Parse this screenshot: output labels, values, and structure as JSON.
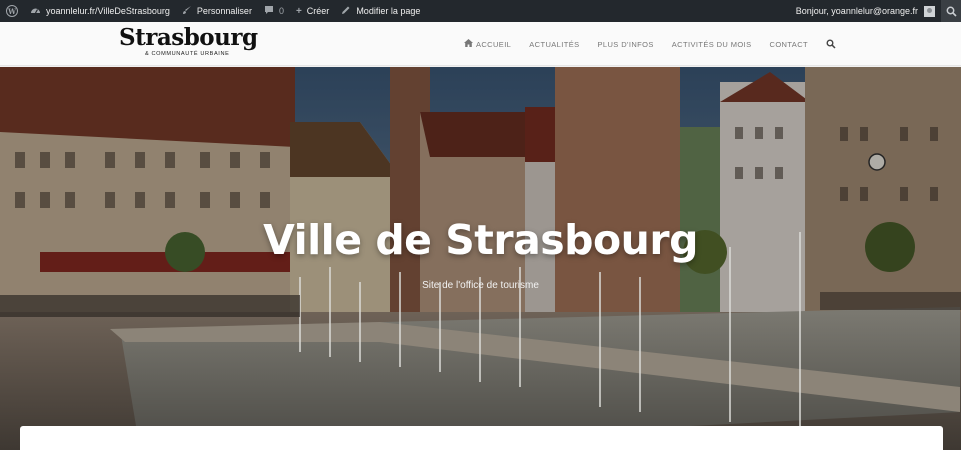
{
  "adminbar": {
    "site": "yoannlelur.fr/VilleDeStrasbourg",
    "customize": "Personnaliser",
    "comments_count": "0",
    "new": "Créer",
    "edit_page": "Modifier la page",
    "greeting": "Bonjour, yoannlelur@orange.fr"
  },
  "header": {
    "logo_main": "Strasbourg",
    "logo_sub": "& COMMUNAUTÉ URBAINE",
    "nav": [
      "ACCUEIL",
      "ACTUALITÉS",
      "PLUS D'INFOS",
      "ACTIVITÉS DU MOIS",
      "CONTACT"
    ]
  },
  "hero": {
    "title": "Ville de Strasbourg",
    "subtitle": "Site de l'office de tourisme"
  },
  "colors": {
    "adminbar": "#23282d",
    "accent": "#ffffff"
  }
}
